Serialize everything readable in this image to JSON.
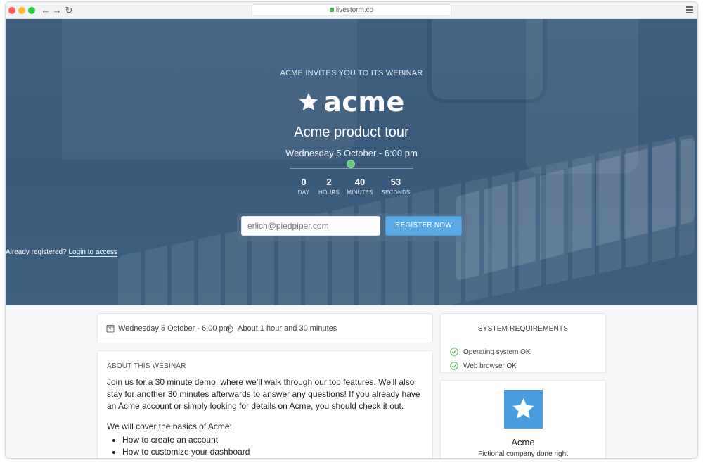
{
  "browser": {
    "url": "livestorm.co"
  },
  "hero": {
    "invite_text": "ACME INVITES YOU TO ITS WEBINAR",
    "logo_text": "acme",
    "event_title": "Acme product tour",
    "event_date": "Wednesday 5 October - 6:00 pm",
    "countdown": [
      {
        "value": "0",
        "label": "DAY"
      },
      {
        "value": "2",
        "label": "HOURS"
      },
      {
        "value": "40",
        "label": "MINUTES"
      },
      {
        "value": "53",
        "label": "SECONDS"
      }
    ],
    "email_placeholder": "erlich@piedpiper.com",
    "register_label": "REGISTER NOW",
    "already_text": "Already registered?",
    "login_link": "Login to access",
    "accent_color": "#5aa9e6"
  },
  "meta": {
    "date": "Wednesday 5 October - 6:00 pm",
    "duration": "About 1 hour and 30 minutes"
  },
  "about": {
    "heading": "ABOUT THIS WEBINAR",
    "body": "Join us for a 30 minute demo, where we’ll walk through our top features. We’ll also stay for another 30 minutes afterwards to answer any questions! If you already have an Acme account or simply looking for details on Acme, you should check it out.",
    "cover_intro": "We will cover the basics of Acme:",
    "cover_items": [
      "How to create an account",
      "How to customize your dashboard"
    ]
  },
  "system": {
    "heading": "SYSTEM REQUIREMENTS",
    "items": [
      "Operating system OK",
      "Web browser OK"
    ],
    "ok_color": "#4caf50"
  },
  "organizer": {
    "name": "Acme",
    "tagline": "Fictional company done right",
    "logo_color": "#4a9ee0"
  }
}
